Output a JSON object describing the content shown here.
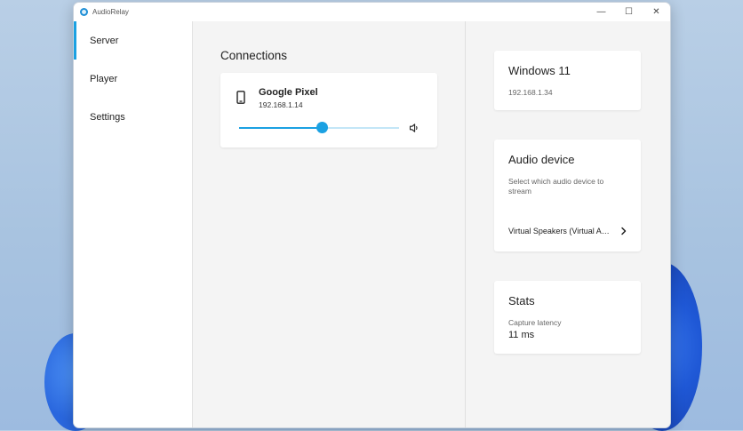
{
  "window": {
    "title": "AudioRelay",
    "minimize_glyph": "—",
    "maximize_glyph": "☐",
    "close_glyph": "✕"
  },
  "sidebar": {
    "items": [
      {
        "label": "Server",
        "active": true
      },
      {
        "label": "Player",
        "active": false
      },
      {
        "label": "Settings",
        "active": false
      }
    ]
  },
  "connections": {
    "title": "Connections",
    "devices": [
      {
        "name": "Google Pixel",
        "ip": "192.168.1.14",
        "volume_percent": 52,
        "icon": "smartphone-icon"
      }
    ]
  },
  "server_info": {
    "title": "Windows 11",
    "ip": "192.168.1.34"
  },
  "audio_device": {
    "title": "Audio device",
    "description": "Select which audio device to stream",
    "selected": "Virtual Speakers (Virtual Audio Device)"
  },
  "stats": {
    "title": "Stats",
    "capture_latency_label": "Capture latency",
    "capture_latency_value": "11 ms"
  },
  "colors": {
    "accent": "#1ba1e2",
    "accent_light": "#c3e6f7"
  }
}
